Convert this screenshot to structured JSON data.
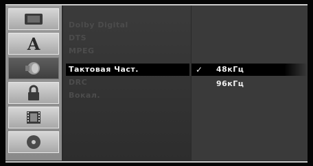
{
  "menu": {
    "icons": [
      {
        "name": "display-icon",
        "active": false
      },
      {
        "name": "language-icon",
        "glyph": "A",
        "active": false
      },
      {
        "name": "audio-icon",
        "active": true
      },
      {
        "name": "lock-icon",
        "active": false
      },
      {
        "name": "recording-icon",
        "active": false
      },
      {
        "name": "disc-icon",
        "active": false
      }
    ],
    "options": [
      {
        "label": "Dolby Digital"
      },
      {
        "label": "DTS"
      },
      {
        "label": "MPEG"
      },
      {
        "label": "Тактовая Част.",
        "selected": true
      },
      {
        "label": "DRC"
      },
      {
        "label": "Вокал."
      }
    ],
    "values": [
      {
        "label": "48кГц",
        "checked": true
      },
      {
        "label": "96кГц"
      }
    ],
    "check_glyph": "✓"
  }
}
